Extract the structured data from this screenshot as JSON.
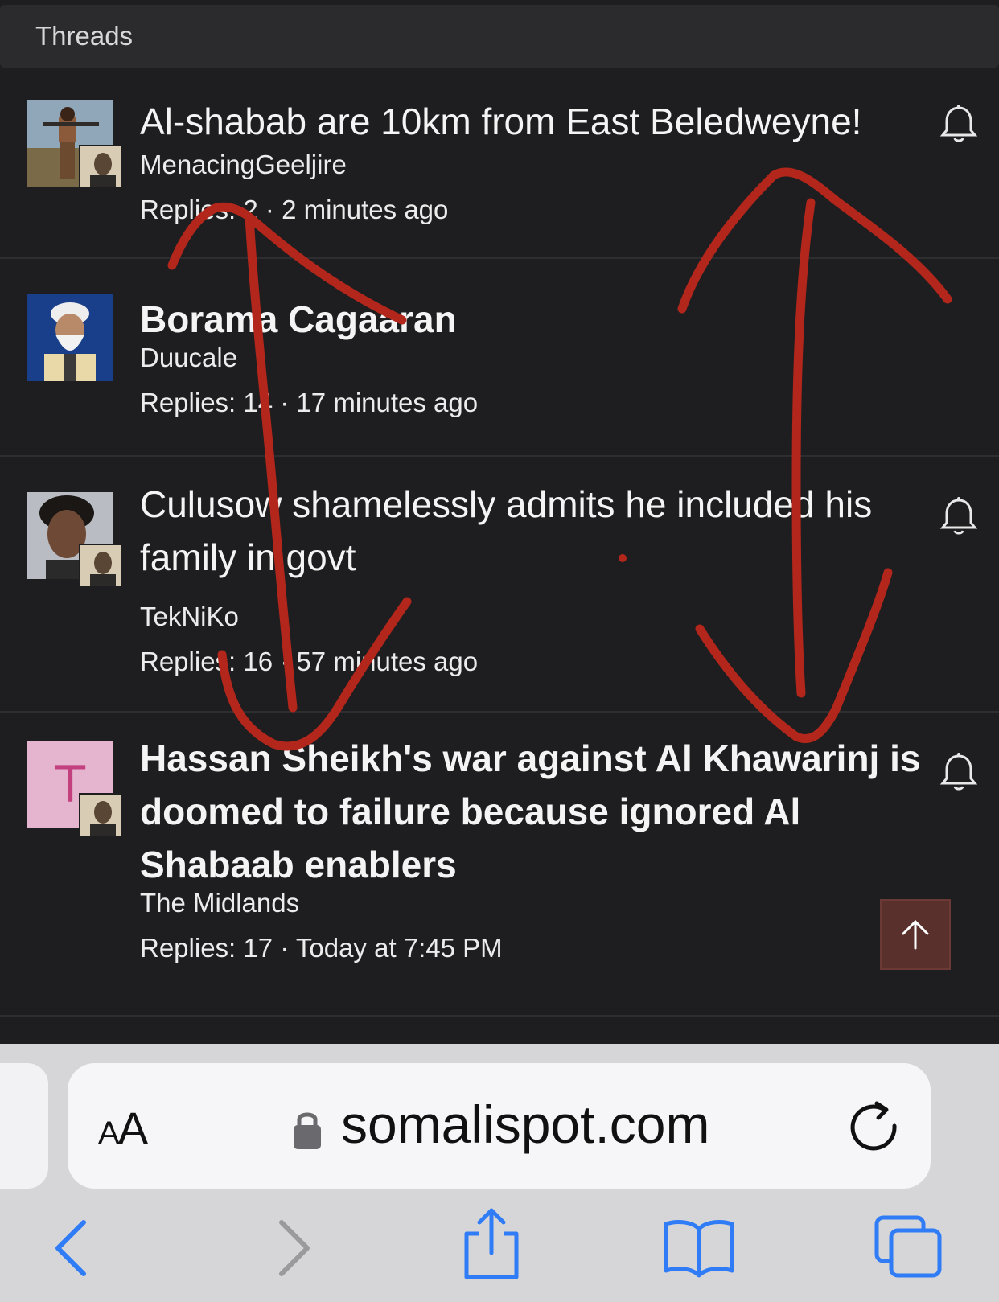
{
  "header": {
    "title": "Threads"
  },
  "threads": [
    {
      "title": "Al-shabab are 10km from East Beledweyne!",
      "author": "MenacingGeeljire",
      "replies_label": "Replies: 2",
      "separator": "·",
      "time": "2 minutes ago",
      "bold": false,
      "has_bell": true
    },
    {
      "title": "Borama Cagaaran",
      "author": "Duucale",
      "replies_label": "Replies: 14",
      "separator": "·",
      "time": "17 minutes ago",
      "bold": true,
      "has_bell": false
    },
    {
      "title": "Culusow shamelessly admits he included his family in govt",
      "author": "TekNiKo",
      "replies_label": "Replies: 16",
      "separator": "·",
      "time": "57 minutes ago",
      "bold": false,
      "has_bell": true
    },
    {
      "title": "Hassan Sheikh's war against Al Khawarinj is doomed to failure because ignored Al Shabaab enablers",
      "author": "The Midlands",
      "replies_label": "Replies: 17",
      "separator": "·",
      "time": "Today at 7:45 PM",
      "bold": true,
      "has_bell": true,
      "avatar_letter": "T"
    }
  ],
  "browser": {
    "text_size_label_small": "A",
    "text_size_label_large": "A",
    "url": "somalispot.com",
    "icons": [
      "lock-icon",
      "reload-icon",
      "back-icon",
      "forward-icon",
      "share-icon",
      "bookmarks-icon",
      "tabs-icon"
    ]
  },
  "colors": {
    "page_bg": "#1e1e20",
    "header_bg": "#2b2b2d",
    "annotation_red": "#b3261b",
    "scroll_top_bg": "#5a302d",
    "toolbar_blue": "#2f7cf6",
    "avatar_letter_bg": "#e5b5cf"
  }
}
